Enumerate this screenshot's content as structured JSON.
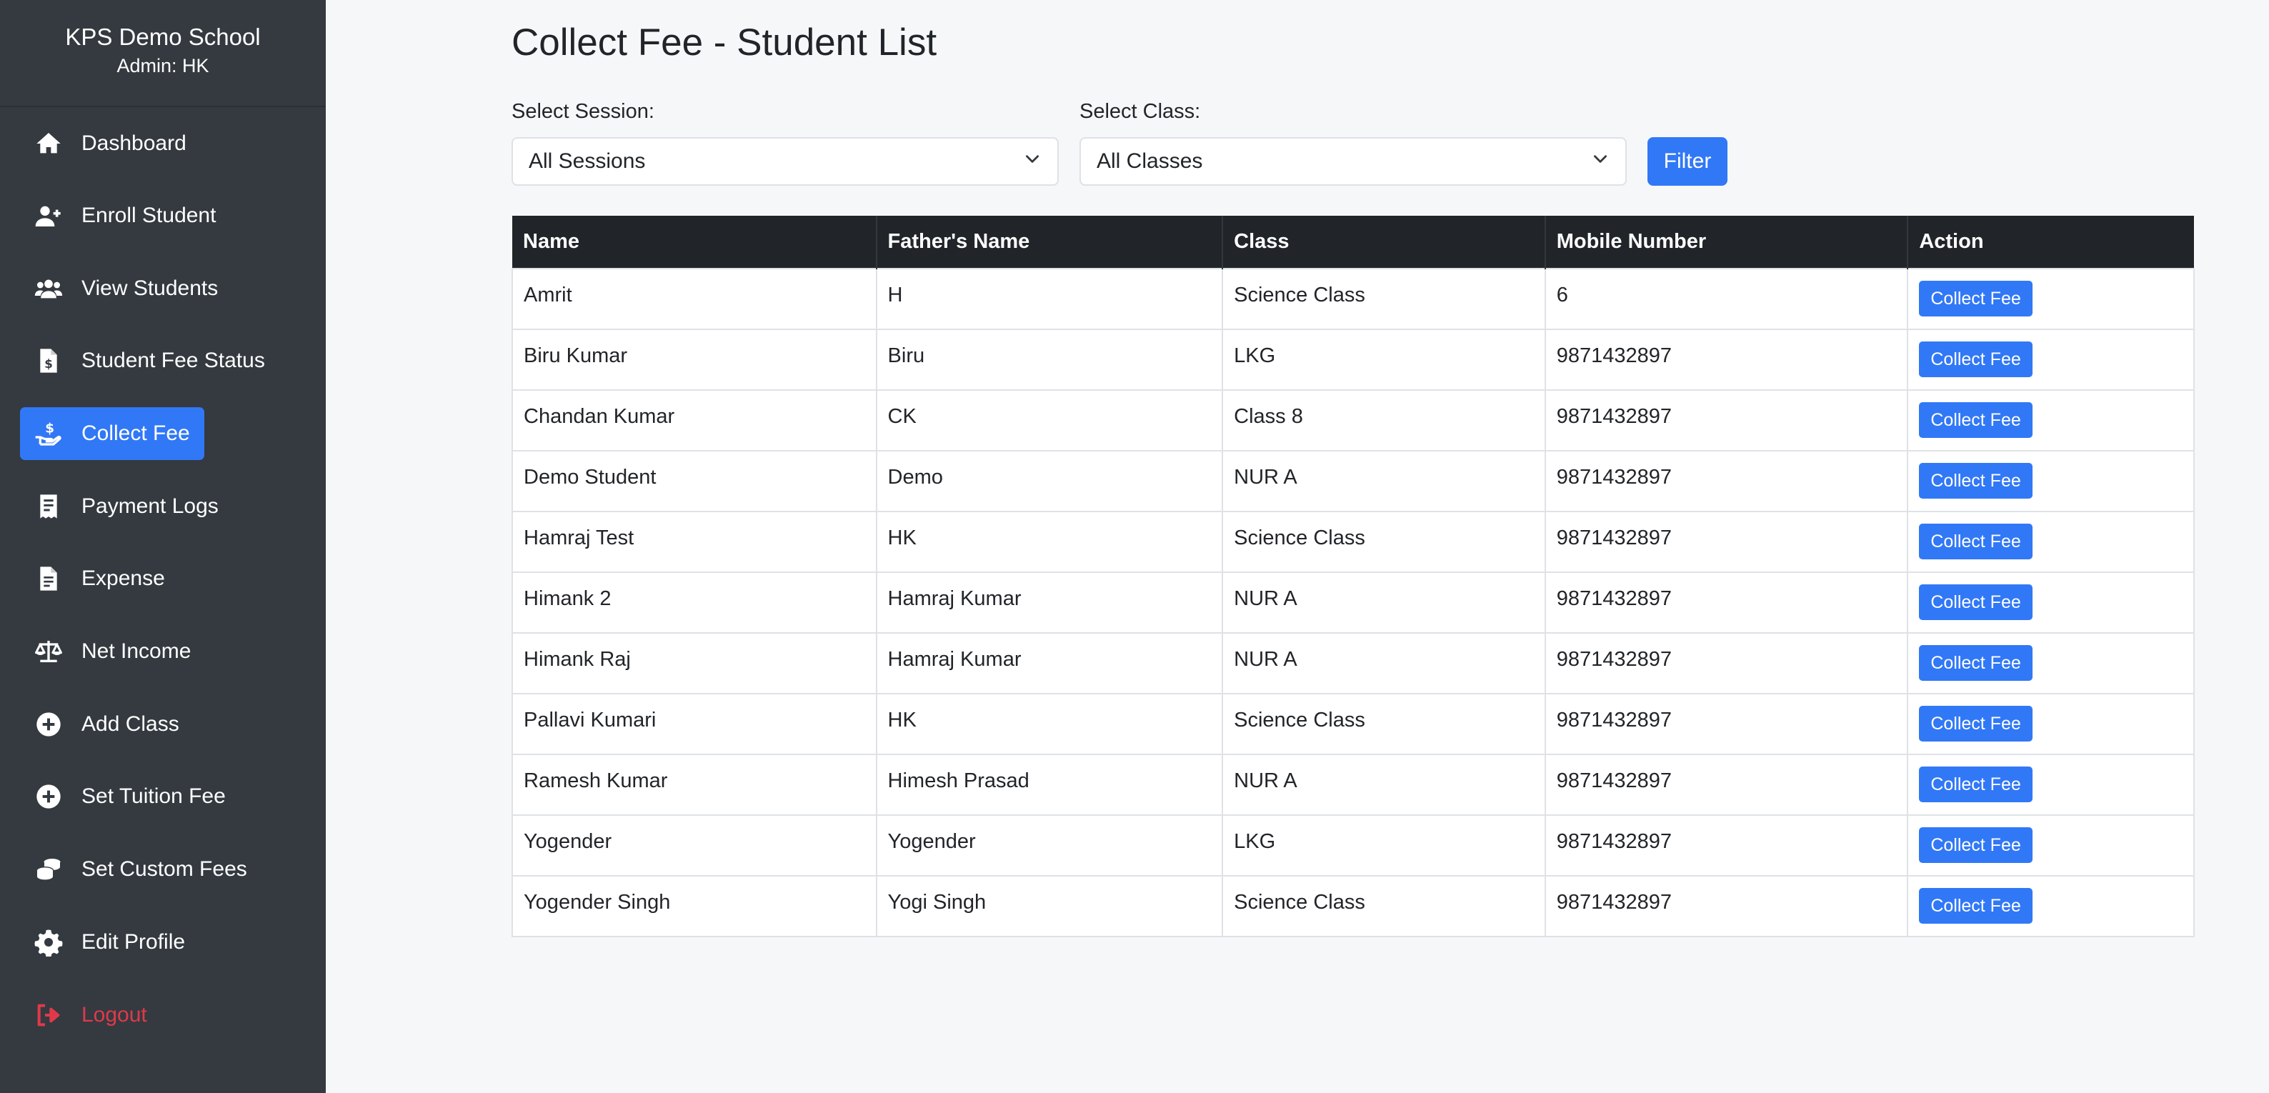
{
  "sidebar": {
    "school_name": "KPS Demo School",
    "admin_label": "Admin: HK",
    "active_color": "#3178f6",
    "items": [
      {
        "label": "Dashboard",
        "icon": "home-icon"
      },
      {
        "label": "Enroll Student",
        "icon": "user-plus-icon"
      },
      {
        "label": "View Students",
        "icon": "users-icon"
      },
      {
        "label": "Student Fee Status",
        "icon": "file-dollar-icon"
      },
      {
        "label": "Collect Fee",
        "icon": "hand-holding-dollar-icon",
        "active": true
      },
      {
        "label": "Payment Logs",
        "icon": "receipt-icon"
      },
      {
        "label": "Expense",
        "icon": "file-invoice-icon"
      },
      {
        "label": "Net Income",
        "icon": "scale-balanced-icon"
      },
      {
        "label": "Add Class",
        "icon": "plus-circle-icon"
      },
      {
        "label": "Set Tuition Fee",
        "icon": "plus-circle-icon"
      },
      {
        "label": "Set Custom Fees",
        "icon": "coins-icon"
      },
      {
        "label": "Edit Profile",
        "icon": "gear-icon"
      },
      {
        "label": "Logout",
        "icon": "sign-out-icon"
      }
    ]
  },
  "page": {
    "title": "Collect Fee - Student List"
  },
  "filters": {
    "session_label": "Select Session:",
    "session_value": "All Sessions",
    "class_label": "Select Class:",
    "class_value": "All Classes",
    "filter_button": "Filter"
  },
  "table": {
    "headers": [
      "Name",
      "Father's Name",
      "Class",
      "Mobile Number",
      "Action"
    ],
    "action_label": "Collect Fee",
    "rows": [
      {
        "name": "Amrit",
        "father": "H",
        "class": "Science Class",
        "mobile": "6"
      },
      {
        "name": "Biru Kumar",
        "father": "Biru",
        "class": "LKG",
        "mobile": "9871432897"
      },
      {
        "name": "Chandan Kumar",
        "father": "CK",
        "class": "Class 8",
        "mobile": "9871432897"
      },
      {
        "name": "Demo Student",
        "father": "Demo",
        "class": "NUR A",
        "mobile": "9871432897"
      },
      {
        "name": "Hamraj Test",
        "father": "HK",
        "class": "Science Class",
        "mobile": "9871432897"
      },
      {
        "name": "Himank 2",
        "father": "Hamraj Kumar",
        "class": "NUR A",
        "mobile": "9871432897"
      },
      {
        "name": "Himank Raj",
        "father": "Hamraj Kumar",
        "class": "NUR A",
        "mobile": "9871432897"
      },
      {
        "name": "Pallavi Kumari",
        "father": "HK",
        "class": "Science Class",
        "mobile": "9871432897"
      },
      {
        "name": "Ramesh Kumar",
        "father": "Himesh Prasad",
        "class": "NUR A",
        "mobile": "9871432897"
      },
      {
        "name": "Yogender",
        "father": "Yogender",
        "class": "LKG",
        "mobile": "9871432897"
      },
      {
        "name": "Yogender Singh",
        "father": "Yogi Singh",
        "class": "Science Class",
        "mobile": "9871432897"
      }
    ]
  }
}
